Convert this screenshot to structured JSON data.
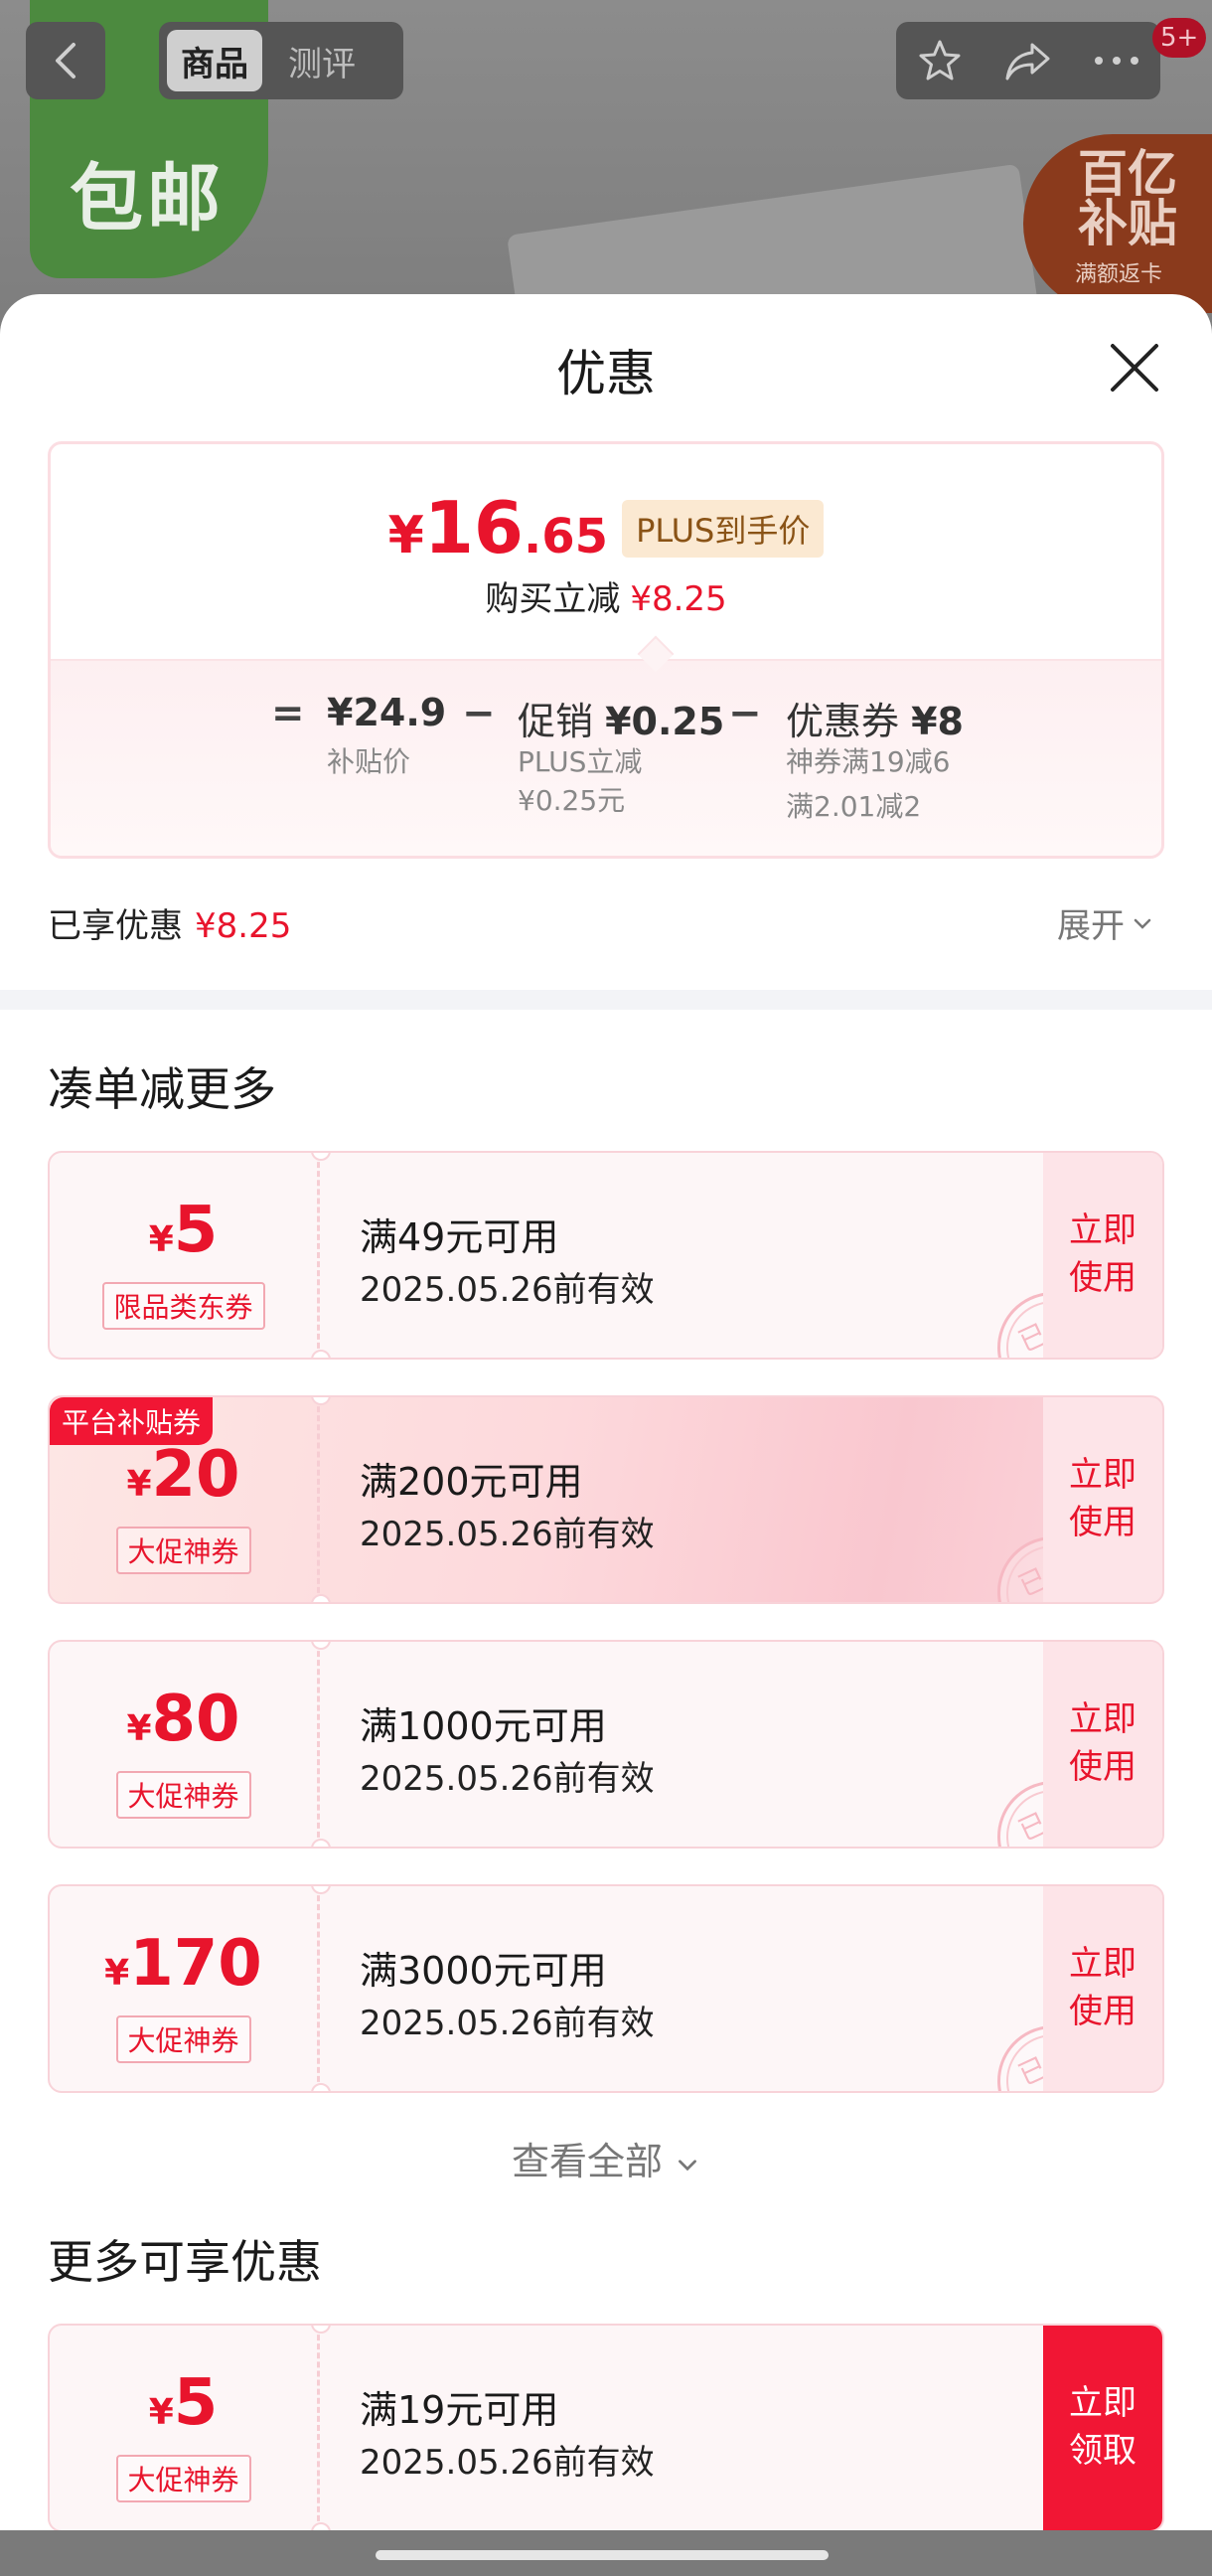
{
  "colors": {
    "accent_red": "#e8142c",
    "sheet_bg": "#ffffff",
    "coupon_bg": "#fdf6f7"
  },
  "topbar": {
    "tabs": [
      {
        "label": "商品",
        "active": true
      },
      {
        "label": "测评",
        "active": false
      }
    ],
    "icons": [
      "back-icon",
      "star-icon",
      "share-icon",
      "more-icon"
    ],
    "message_count": "5+"
  },
  "background": {
    "promo_text": "包邮",
    "badge_title": "百亿补贴",
    "badge_sub": "满额返卡"
  },
  "sheet": {
    "title": "优惠",
    "price": {
      "currency": "¥",
      "integer": "16",
      "decimal": ".65",
      "tag": "PLUS到手价",
      "instant_label": "购买立减",
      "instant_value": "¥8.25"
    },
    "breakdown": {
      "op_equal": "=",
      "op_minus": "−",
      "base_value": "¥24.9",
      "base_label": "补贴价",
      "promo_label": "促销",
      "promo_value": "¥0.25",
      "promo_sub1": "PLUS立减",
      "promo_sub2": "¥0.25元",
      "coupon_label": "优惠券",
      "coupon_value": "¥8",
      "coupon_sub1": "神券满19减6",
      "coupon_sub2": "满2.01减2"
    },
    "enjoyed": {
      "label": "已享优惠",
      "value": "¥8.25",
      "expand_label": "展开"
    },
    "section1_title": "凑单减更多",
    "coupons": [
      {
        "currency": "¥",
        "amount": "5",
        "type": "限品类东券",
        "condition": "满49元可用",
        "date": "2025.05.26前有效",
        "action": "立即使用",
        "stamp": "已领",
        "tag": ""
      },
      {
        "currency": "¥",
        "amount": "20",
        "type": "大促神券",
        "condition": "满200元可用",
        "date": "2025.05.26前有效",
        "action": "立即使用",
        "stamp": "已领",
        "tag": "平台补贴券"
      },
      {
        "currency": "¥",
        "amount": "80",
        "type": "大促神券",
        "condition": "满1000元可用",
        "date": "2025.05.26前有效",
        "action": "立即使用",
        "stamp": "已领",
        "tag": ""
      },
      {
        "currency": "¥",
        "amount": "170",
        "type": "大促神券",
        "condition": "满3000元可用",
        "date": "2025.05.26前有效",
        "action": "立即使用",
        "stamp": "已领",
        "tag": ""
      }
    ],
    "see_all": "查看全部",
    "section2_title": "更多可享优惠",
    "more_coupons": [
      {
        "currency": "¥",
        "amount": "5",
        "type": "大促神券",
        "condition": "满19元可用",
        "date": "2025.05.26前有效",
        "action": "立即领取"
      }
    ]
  }
}
